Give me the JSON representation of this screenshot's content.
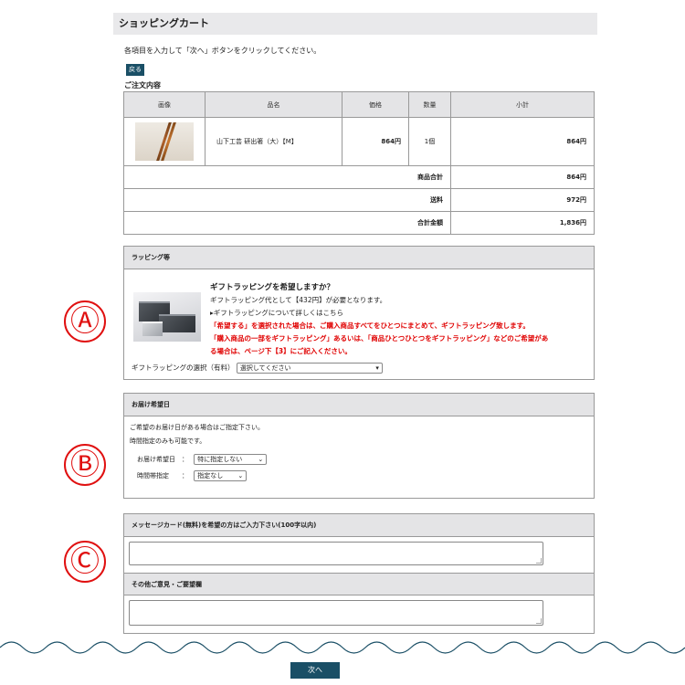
{
  "header": {
    "title": "ショッピングカート"
  },
  "intro": "各項目を入力して「次へ」ボタンをクリックしてください。",
  "back_label": "戻る",
  "order": {
    "heading": "ご注文内容",
    "columns": [
      "画像",
      "品名",
      "価格",
      "数量",
      "小計"
    ],
    "item": {
      "name": "山下工芸 研出箸（大）【M】",
      "price": "864円",
      "qty": "1個",
      "subtotal": "864円"
    },
    "sums": [
      {
        "label": "商品合計",
        "value": "864円"
      },
      {
        "label": "送料",
        "value": "972円"
      },
      {
        "label": "合計金額",
        "value": "1,836円"
      }
    ]
  },
  "wrapping": {
    "heading": "ラッピング等",
    "question": "ギフトラッピングを希望しますか？",
    "fee_note": "ギフトラッピング代として【432円】が必要となります。",
    "link": "ギフトラッピングについて詳しくはこちら",
    "warn1": "「希望する」を選択された場合は、ご購入商品すべてをひとつにまとめて、ギフトラッピング致します。",
    "warn2a": "「購入商品の一部をギフトラッピング」あるいは、「商品ひとつひとつをギフトラッピング」などのご希望があ",
    "warn2b": "る場合は、ページ下【3】にご記入ください。",
    "select_label": "ギフトラッピングの選択（有料）",
    "select_value": "選択してください"
  },
  "delivery": {
    "heading": "お届け希望日",
    "note1": "ご希望のお届け日がある場合はご指定下さい。",
    "note2": "時間指定のみも可能です。",
    "date_label": "お届け希望日　：",
    "date_value": "特に指定しない",
    "time_label": "時間帯指定　　：",
    "time_value": "指定なし"
  },
  "message": {
    "heading": "メッセージカード(無料)を希望の方はご入力下さい(100字以内)"
  },
  "comments": {
    "heading": "その他ご意見・ご要望欄"
  },
  "markers": [
    "Ⓐ",
    "Ⓑ",
    "Ⓒ"
  ],
  "next_label": "次へ"
}
